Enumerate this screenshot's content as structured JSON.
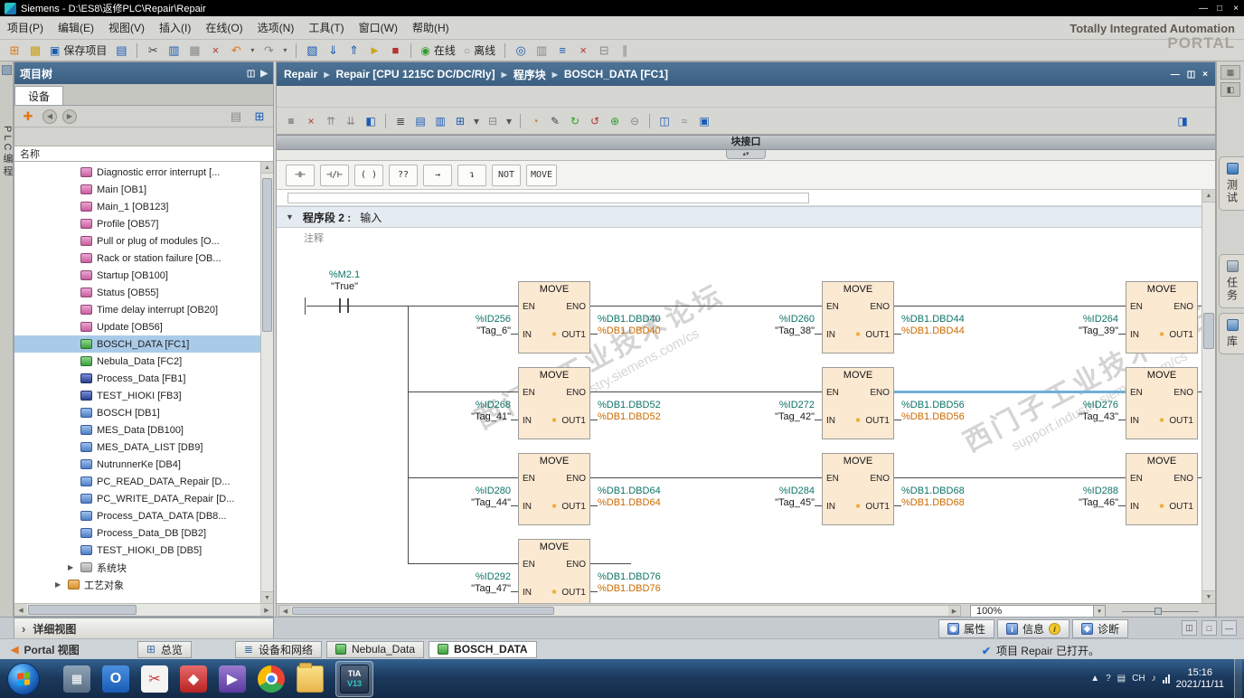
{
  "icons": {
    "up": "▲",
    "down": "▼",
    "left": "◀",
    "right": "▶",
    "close": "×",
    "min": "—",
    "max": "□",
    "restore": "◫",
    "check": "✔",
    "chev": "›",
    "dd": "▾",
    "grip": "▴▾",
    "star": "*",
    "sep": "▶"
  },
  "window": {
    "title": "Siemens  -  D:\\ES8\\返修PLC\\Repair\\Repair"
  },
  "brand": {
    "line1": "Totally Integrated Automation",
    "line2": "PORTAL"
  },
  "menu": {
    "items": [
      "项目(P)",
      "编辑(E)",
      "视图(V)",
      "插入(I)",
      "在线(O)",
      "选项(N)",
      "工具(T)",
      "窗口(W)",
      "帮助(H)"
    ]
  },
  "main_toolbar": {
    "save": "保存项目",
    "online": "在线",
    "offline": "离线",
    "file_icons": [
      "⊞",
      "▩",
      "▣",
      "▤"
    ],
    "edit_icons": [
      "✂",
      "▥",
      "▦",
      "×"
    ],
    "undo": "↶",
    "redo": "↷",
    "net_icons": [
      "▧",
      "⇓",
      "⇑",
      "►",
      "■"
    ],
    "online_icon": "◉",
    "offline_icon": "○",
    "right_icons": [
      "◎",
      "▥",
      "≡",
      "×",
      "⊟",
      "∥"
    ]
  },
  "left_strip": {
    "label": "PLC编程"
  },
  "project_tree": {
    "title": "项目树",
    "header_icons": [
      "◫",
      "▶"
    ],
    "tab": "设备",
    "tool_left": [
      "✚",
      "◀",
      "▶"
    ],
    "tool_right": [
      "▤",
      "⊞"
    ],
    "name_header": "名称",
    "items": [
      {
        "label": "Diagnostic error interrupt [...",
        "icon": "ob"
      },
      {
        "label": "Main [OB1]",
        "icon": "ob"
      },
      {
        "label": "Main_1 [OB123]",
        "icon": "ob"
      },
      {
        "label": "Profile [OB57]",
        "icon": "ob"
      },
      {
        "label": "Pull or plug of modules [O...",
        "icon": "ob"
      },
      {
        "label": "Rack or station failure [OB...",
        "icon": "ob"
      },
      {
        "label": "Startup [OB100]",
        "icon": "ob"
      },
      {
        "label": "Status [OB55]",
        "icon": "ob"
      },
      {
        "label": "Time delay interrupt [OB20]",
        "icon": "ob"
      },
      {
        "label": "Update [OB56]",
        "icon": "ob"
      },
      {
        "label": "BOSCH_DATA [FC1]",
        "icon": "fc",
        "selected": true
      },
      {
        "label": "Nebula_Data [FC2]",
        "icon": "fc"
      },
      {
        "label": "Process_Data [FB1]",
        "icon": "fb"
      },
      {
        "label": "TEST_HIOKI [FB3]",
        "icon": "fb"
      },
      {
        "label": "BOSCH [DB1]",
        "icon": "db"
      },
      {
        "label": "MES_Data [DB100]",
        "icon": "db"
      },
      {
        "label": "MES_DATA_LIST [DB9]",
        "icon": "db"
      },
      {
        "label": "NutrunnerKe [DB4]",
        "icon": "db"
      },
      {
        "label": "PC_READ_DATA_Repair [D...",
        "icon": "db"
      },
      {
        "label": "PC_WRITE_DATA_Repair [D...",
        "icon": "db"
      },
      {
        "label": "Process_DATA_DATA [DB8...",
        "icon": "db"
      },
      {
        "label": "Process_Data_DB [DB2]",
        "icon": "db"
      },
      {
        "label": "TEST_HIOKI_DB [DB5]",
        "icon": "db"
      }
    ],
    "sys_item": "系统块",
    "tech_item": "工艺对象",
    "detail_view": "详细视图"
  },
  "breadcrumb": {
    "items": [
      "Repair",
      "Repair [CPU 1215C DC/DC/Rly]",
      "程序块",
      "BOSCH_DATA [FC1]"
    ]
  },
  "editor": {
    "toolbar_icons": [
      "≡",
      "×",
      "⇈",
      "⇊",
      "◧",
      "≣",
      "▤",
      "▥",
      "⊞",
      "▾",
      "⊟",
      "▾",
      "◔",
      "✎",
      "↻",
      "↺",
      "⊕",
      "⊖",
      "◫",
      "≈",
      "▣"
    ],
    "toolbar_right_icon": "◨",
    "iface": "块接口",
    "favorites": [
      "⊣⊢",
      "⊣/⊢",
      "( )",
      "??",
      "→",
      "↴",
      "NOT",
      "MOVE"
    ],
    "network": {
      "num": "程序段 2 :",
      "name": "输入",
      "comment": "注释"
    },
    "zoom": "100%"
  },
  "ladder": {
    "contact": {
      "addr": "%M2.1",
      "tag": "\"True\""
    },
    "box": {
      "title": "MOVE",
      "en": "EN",
      "eno": "ENO",
      "in": "IN",
      "out1": "OUT1"
    },
    "rows": [
      {
        "blocks": [
          {
            "in_addr": "%ID256",
            "in_tag": "\"Tag_6\"",
            "out_addr": "%DB1.DBD40",
            "out_sub": "%DB1.DBD40"
          },
          {
            "in_addr": "%ID260",
            "in_tag": "\"Tag_38\"",
            "out_addr": "%DB1.DBD44",
            "out_sub": "%DB1.DBD44"
          },
          {
            "in_addr": "%ID264",
            "in_tag": "\"Tag_39\""
          }
        ]
      },
      {
        "blocks": [
          {
            "in_addr": "%ID268",
            "in_tag": "\"Tag_41\"",
            "out_addr": "%DB1.DBD52",
            "out_sub": "%DB1.DBD52"
          },
          {
            "in_addr": "%ID272",
            "in_tag": "\"Tag_42\"",
            "out_addr": "%DB1.DBD56",
            "out_sub": "%DB1.DBD56"
          },
          {
            "in_addr": "%ID276",
            "in_tag": "\"Tag_43\""
          }
        ]
      },
      {
        "blocks": [
          {
            "in_addr": "%ID280",
            "in_tag": "\"Tag_44\"",
            "out_addr": "%DB1.DBD64",
            "out_sub": "%DB1.DBD64"
          },
          {
            "in_addr": "%ID284",
            "in_tag": "\"Tag_45\"",
            "out_addr": "%DB1.DBD68",
            "out_sub": "%DB1.DBD68"
          },
          {
            "in_addr": "%ID288",
            "in_tag": "\"Tag_46\""
          }
        ]
      },
      {
        "blocks": [
          {
            "in_addr": "%ID292",
            "in_tag": "\"Tag_47\"",
            "out_addr": "%DB1.DBD76",
            "out_sub": "%DB1.DBD76"
          }
        ]
      }
    ],
    "watermark": {
      "l1": "西门子工业技术论坛",
      "l2": "support.industry.siemens.com/cs"
    }
  },
  "right_strip": {
    "top_icons": [
      "▦",
      "◧"
    ],
    "tabs": [
      {
        "label": "测试"
      },
      {
        "label": "任务"
      },
      {
        "label": "库"
      }
    ]
  },
  "props_tabs": {
    "tabs": [
      {
        "icon": "◉",
        "label": "属性"
      },
      {
        "icon": "i",
        "label": "信息",
        "badge": "i"
      },
      {
        "icon": "◆",
        "label": "诊断"
      }
    ]
  },
  "portal_bar": {
    "back": "Portal 视图",
    "tabs": [
      {
        "icon": "⊞",
        "label": "总览"
      },
      {
        "icon": "≣",
        "label": "设备和网络"
      },
      {
        "label": "Nebula_Data"
      },
      {
        "label": "BOSCH_DATA"
      }
    ],
    "status": "项目 Repair 已打开。"
  },
  "taskbar": {
    "outlook": "O",
    "snip": "✂",
    "player": "▶",
    "calc": "▦",
    "red": "◆",
    "tia_line1": "TIA",
    "tia_line2": "V13",
    "tray": [
      "▲",
      "?",
      "▤",
      "♪"
    ],
    "lang": "CH",
    "time": "15:16",
    "date": "2021/11/11"
  }
}
